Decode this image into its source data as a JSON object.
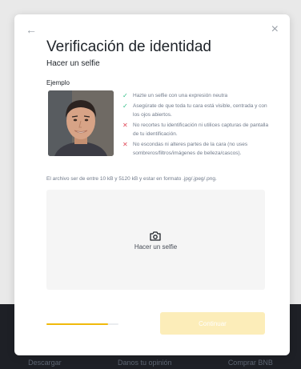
{
  "colors": {
    "accent": "#f0b90b",
    "ok": "#2ebd85",
    "error": "#e04a59",
    "button_disabled": "#fcedb9"
  },
  "background_footer": [
    "Descargar",
    "Danos tu opinión",
    "Comprar BNB"
  ],
  "modal": {
    "back_icon": "arrow-left-icon",
    "close_icon": "close-icon",
    "title": "Verificación de identidad",
    "subtitle": "Hacer un selfie",
    "example_label": "Ejemplo",
    "rules": [
      {
        "type": "ok",
        "icon": "check-icon",
        "text": "Hazte un selfie con una expresión neutra"
      },
      {
        "type": "ok",
        "icon": "check-icon",
        "text": "Asegúrate de que toda tu cara está visible, centrada y con los ojos abiertos."
      },
      {
        "type": "no",
        "icon": "cross-icon",
        "text": "No recortes tu identificación ni utilices capturas de pantalla de tu identificación."
      },
      {
        "type": "no",
        "icon": "cross-icon",
        "text": "No escondas ni alteres partes de la cara (no uses sombreros/filtros/imágenes de belleza/cascos)."
      }
    ],
    "file_note": "El archivo ser de entre 10 kB y 5120 kB y estar en formato .jpg/.jpeg/.png.",
    "upload": {
      "icon": "camera-icon",
      "label": "Hacer un selfie"
    },
    "progress": 0.85,
    "continue_label": "Continuar"
  }
}
